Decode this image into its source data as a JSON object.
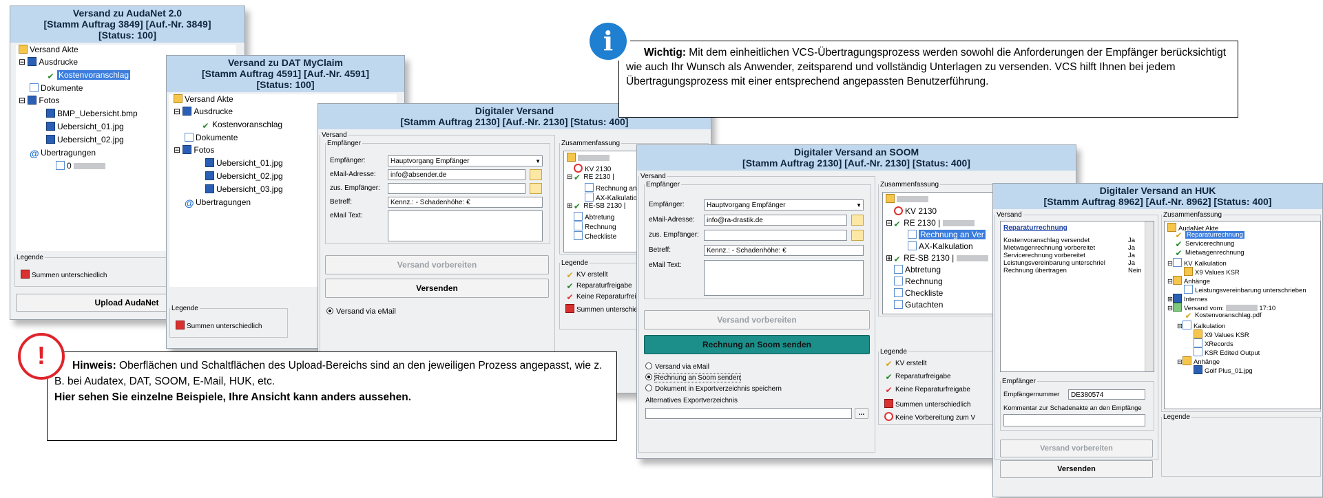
{
  "win1": {
    "title": [
      "Versand zu AudaNet 2.0",
      "[Stamm Auftrag 3849] [Auf.-Nr. 3849]",
      "[Status: 100]"
    ],
    "tree": [
      "Versand Akte",
      "Ausdrucke",
      "Kostenvoranschlag",
      "Dokumente",
      "Fotos",
      "BMP_Uebersicht.bmp",
      "Uebersicht_01.jpg",
      "Uebersicht_02.jpg",
      "Ubertragungen",
      "0"
    ],
    "legend_title": "Legende",
    "legend_item": "Summen unterschiedlich",
    "upload_button": "Upload AudaNet"
  },
  "win2": {
    "title": [
      "Versand zu DAT MyClaim",
      "[Stamm Auftrag 4591] [Auf.-Nr. 4591]",
      "[Status: 100]"
    ],
    "tree": [
      "Versand Akte",
      "Ausdrucke",
      "Kostenvoranschlag",
      "Dokumente",
      "Fotos",
      "Uebersicht_01.jpg",
      "Uebersicht_02.jpg",
      "Uebersicht_03.jpg",
      "Ubertragungen"
    ],
    "legend_title": "Legende",
    "legend_item": "Summen unterschiedlich"
  },
  "win3": {
    "title": [
      "Digitaler Versand",
      "[Stamm Auftrag 2130] [Auf.-Nr. 2130] [Status: 400]"
    ],
    "group_versand": "Versand",
    "group_empfaenger": "Empfänger",
    "lbl_empfaenger": "Empfänger:",
    "val_empfaenger": "Hauptvorgang Empfänger",
    "lbl_email": "eMail-Adresse:",
    "val_email": "info@absender.de",
    "lbl_zus": "zus. Empfänger:",
    "lbl_betreff": "Betreff:",
    "val_betreff": "Kennz.:          - Schadenhöhe:        €",
    "lbl_text": "eMail Text:",
    "btn_prepare": "Versand vorbereiten",
    "btn_send": "Versenden",
    "radio_email": "Versand via eMail",
    "summary_title": "Zusammenfassung",
    "summary": [
      "KV 2130",
      "RE 2130 |",
      "Rechnung an",
      "AX-Kalkulation",
      "RE-SB 2130 |",
      "Abtretung",
      "Rechnung",
      "Checkliste"
    ],
    "legend_title": "Legende",
    "legend": [
      "KV erstellt",
      "Reparaturfreigabe",
      "Keine Reparaturfreigabe",
      "Summen unterschiedlich"
    ]
  },
  "win4": {
    "title": [
      "Digitaler Versand an SOOM",
      "[Stamm Auftrag 2130] [Auf.-Nr. 2130] [Status: 400]"
    ],
    "group_versand": "Versand",
    "group_empfaenger": "Empfänger",
    "lbl_empfaenger": "Empfänger:",
    "val_empfaenger": "Hauptvorgang Empfänger",
    "lbl_email": "eMail-Adresse:",
    "val_email": "info@ra-drastik.de",
    "lbl_zus": "zus. Empfänger:",
    "lbl_betreff": "Betreff:",
    "val_betreff": "Kennz.:          - Schadenhöhe:        €",
    "lbl_text": "eMail Text:",
    "btn_prepare": "Versand vorbereiten",
    "btn_send": "Rechnung an Soom senden",
    "radios": [
      "Versand via eMail",
      "Rechnung an Soom senden",
      "Dokument in Exportverzeichnis speichern"
    ],
    "alt_export": "Alternatives Exportverzeichnis",
    "browse": "...",
    "summary_title": "Zusammenfassung",
    "summary": [
      "KV 2130",
      "RE 2130 |",
      "Rechnung an Ver",
      "AX-Kalkulation",
      "RE-SB 2130 |",
      "Abtretung",
      "Rechnung",
      "Checkliste",
      "Gutachten"
    ],
    "legend_title": "Legende",
    "legend": [
      "KV erstellt",
      "Reparaturfreigabe",
      "Keine Reparaturfreigabe",
      "Summen unterschiedlich",
      "Keine Vorbereitung zum V"
    ]
  },
  "win5": {
    "title": [
      "Digitaler Versand an HUK",
      "[Stamm Auftrag 8962] [Auf.-Nr. 8962] [Status: 400]"
    ],
    "group_versand": "Versand",
    "link": "Reparaturrechnung",
    "rows": [
      {
        "label": "Kostenvoranschlag versendet",
        "value": "Ja"
      },
      {
        "label": "Mietwagenrechnung vorbereitet",
        "value": "Ja"
      },
      {
        "label": "Servicerechnung vorbereitet",
        "value": "Ja"
      },
      {
        "label": "Leistungsvereinbarung unterschriel",
        "value": "Ja"
      },
      {
        "label": "Rechnung übertragen",
        "value": "Nein"
      }
    ],
    "group_empfaenger": "Empfänger",
    "lbl_nummer": "Empfängernummer",
    "val_nummer": "DE380574",
    "lbl_kommentar": "Kommentar zur Schadenakte an den Empfänge",
    "btn_prepare": "Versand vorbereiten",
    "btn_send": "Versenden",
    "summary_title": "Zusammenfassung",
    "summary": [
      "AudaNet Akte",
      "Reparaturrechnung",
      "Servicerechnung",
      "Mietwagenrechnung",
      "KV Kalkulation",
      "X9 Values KSR",
      "Anhänge",
      "Leistungsvereinbarung unterschrieben",
      "Internes",
      "Versand vom:",
      "17:10",
      "Kostenvoranschlag.pdf",
      "Kalkulation",
      "X9 Values KSR",
      "XRecords",
      "KSR Edited Output",
      "Anhänge",
      "Golf Plus_01.jpg"
    ],
    "legend_title": "Legende"
  },
  "callout_info": {
    "bold": "Wichtig:",
    "text": " Mit dem einheitlichen VCS-Übertragungsprozess werden sowohl die Anforderungen der Empfänger berücksichtigt wie auch Ihr Wunsch als Anwender, zeitsparend und vollständig Unterlagen zu versenden. VCS hilft Ihnen bei jedem Übertragungsprozess mit einer entsprechend angepassten Benutzerführung.",
    "icon_glyph": "i",
    "accent": "#1f7fd1"
  },
  "callout_note": {
    "bold": "Hinweis:",
    "text": " Oberflächen und Schaltflächen des Upload-Bereichs sind an den jeweiligen Prozess angepasst, wie z. B. bei Audatex, DAT, SOOM, E-Mail, HUK, etc.",
    "bold_line": "Hier sehen Sie einzelne Beispiele, Ihre Ansicht kann anders aussehen.",
    "icon_glyph": "!",
    "accent": "#e0242c"
  }
}
